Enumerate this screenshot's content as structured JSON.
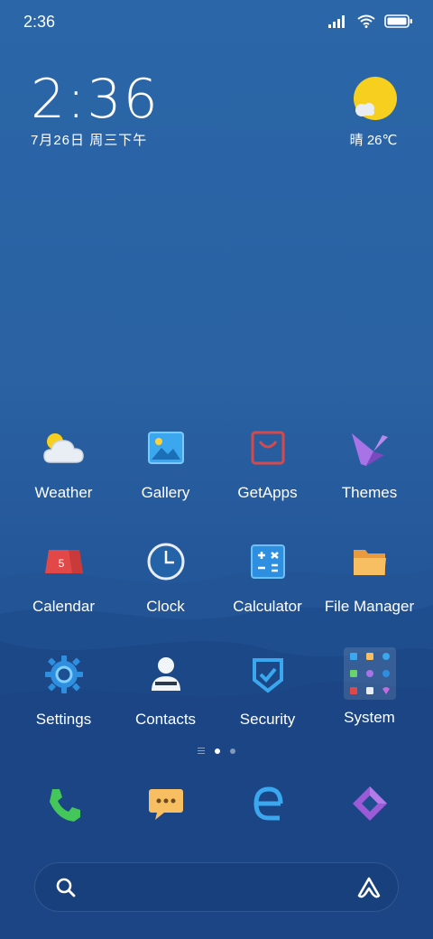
{
  "status_bar": {
    "time": "2:36",
    "icons": [
      "signal-icon",
      "wifi-icon",
      "battery-icon"
    ]
  },
  "clock_widget": {
    "time": "2:36",
    "date": "7月26日 周三下午"
  },
  "weather_widget": {
    "condition": "晴",
    "temperature": "26℃"
  },
  "apps": [
    {
      "label": "Weather",
      "icon": "weather-icon"
    },
    {
      "label": "Gallery",
      "icon": "gallery-icon"
    },
    {
      "label": "GetApps",
      "icon": "getapps-icon"
    },
    {
      "label": "Themes",
      "icon": "themes-icon"
    },
    {
      "label": "Calendar",
      "icon": "calendar-icon",
      "badge": "5"
    },
    {
      "label": "Clock",
      "icon": "clock-icon"
    },
    {
      "label": "Calculator",
      "icon": "calculator-icon"
    },
    {
      "label": "File Manager",
      "icon": "file-manager-icon"
    },
    {
      "label": "Settings",
      "icon": "settings-icon"
    },
    {
      "label": "Contacts",
      "icon": "contacts-icon"
    },
    {
      "label": "Security",
      "icon": "security-icon"
    },
    {
      "label": "System",
      "icon": "system-folder-icon"
    }
  ],
  "pager": {
    "pages": 2,
    "current": 1
  },
  "dock": [
    "phone-icon",
    "messages-icon",
    "browser-icon",
    "app-store-icon"
  ],
  "search_bar": {
    "left_icon": "search-icon",
    "right_icon": "assistant-icon"
  }
}
